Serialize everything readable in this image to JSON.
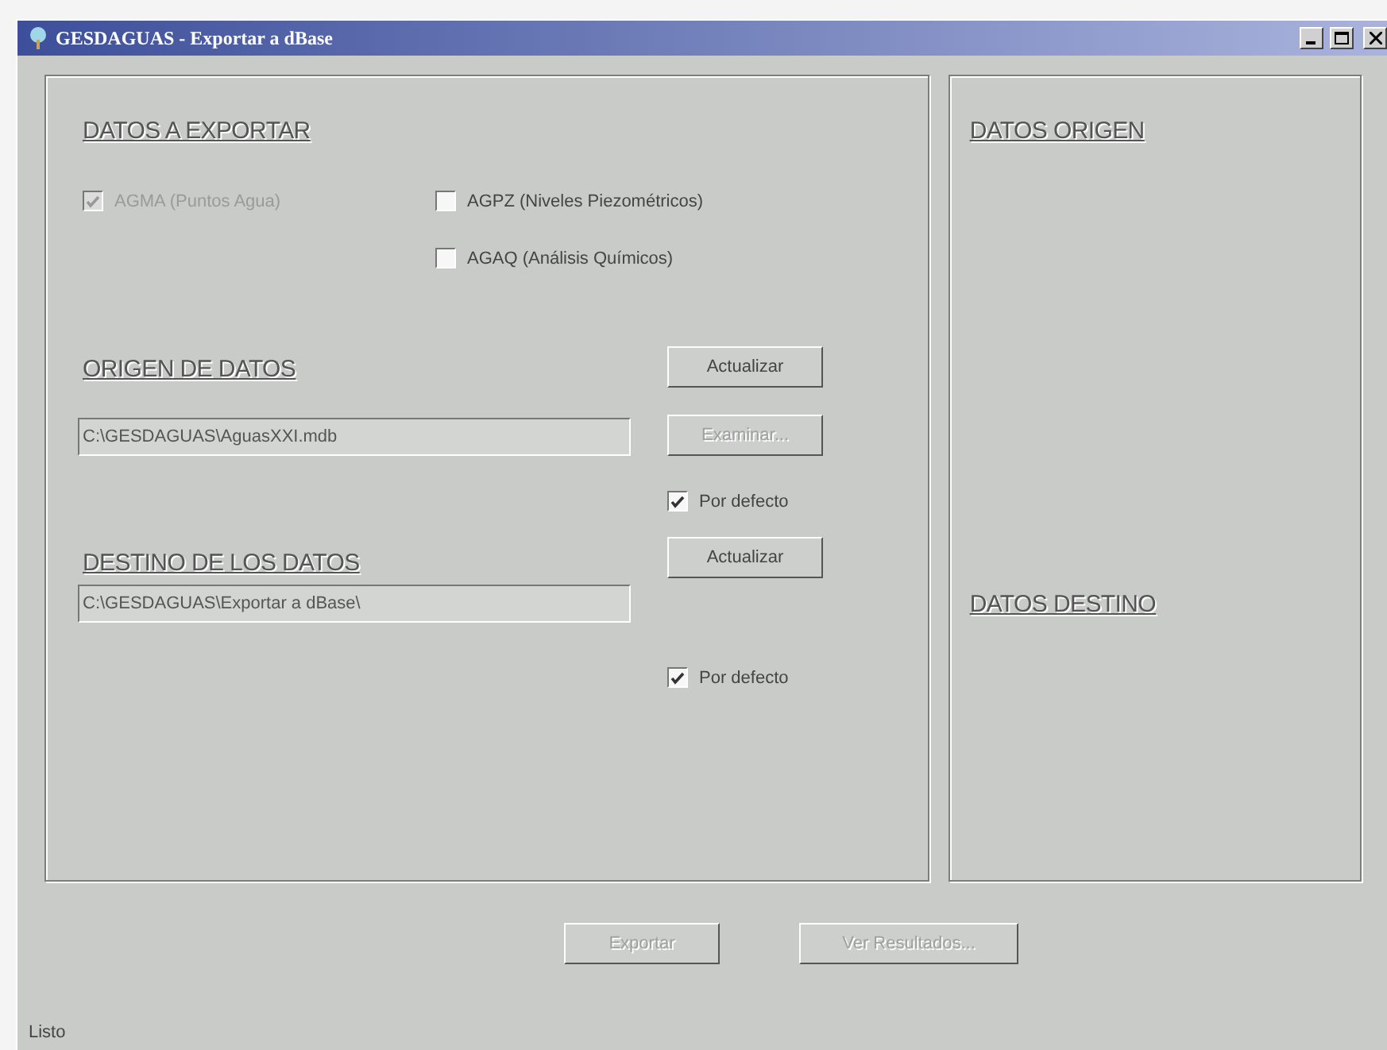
{
  "window": {
    "title": "GESDAGUAS - Exportar a dBase"
  },
  "export_panel": {
    "heading": "DATOS A EXPORTAR",
    "tables": [
      {
        "label": "AGMA (Puntos Agua)",
        "checked": true,
        "disabled": true
      },
      {
        "label": "AGPZ (Niveles Piezométricos)",
        "checked": false,
        "disabled": false
      },
      {
        "label": "AGAQ (Análisis Químicos)",
        "checked": false,
        "disabled": false
      }
    ],
    "source": {
      "heading": "ORIGEN DE DATOS",
      "refresh_button": {
        "label": "Actualizar",
        "disabled": false
      },
      "path": "C:\\GESDAGUAS\\AguasXXI.mdb",
      "browse_button": {
        "label": "Examinar...",
        "disabled": true
      },
      "default": {
        "label": "Por defecto",
        "checked": true
      }
    },
    "destination": {
      "heading": "DESTINO DE LOS DATOS",
      "refresh_button": {
        "label": "Actualizar",
        "disabled": false
      },
      "path": "C:\\GESDAGUAS\\Exportar a dBase\\",
      "default": {
        "label": "Por defecto",
        "checked": true
      }
    }
  },
  "info_panel": {
    "source_heading": "DATOS ORIGEN",
    "destination_heading": "DATOS DESTINO"
  },
  "buttons": [
    {
      "label": "Exportar",
      "disabled": true
    },
    {
      "label": "Ver Resultados...",
      "disabled": true
    }
  ],
  "status_bar": {
    "text": "Listo"
  }
}
